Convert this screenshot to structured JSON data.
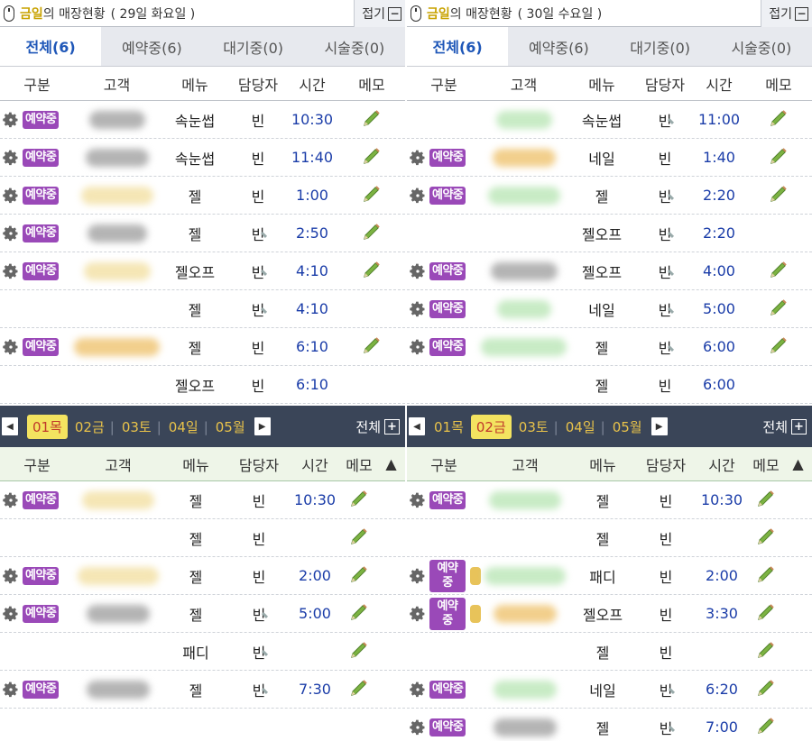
{
  "columns": [
    "구분",
    "고객",
    "메뉴",
    "담당자",
    "시간",
    "메모"
  ],
  "badge_label": "예약중",
  "collapse_label": "접기",
  "all_label": "전체",
  "sort_icon": "▲",
  "panels": [
    {
      "id": "tl",
      "title_highlight": "금일",
      "title_rest": "의 매장현황",
      "title_date": "( 29일 화요일 )",
      "tabs": [
        "전체(6)",
        "예약중(6)",
        "대기중(0)",
        "시술중(0)"
      ],
      "active_tab": 0,
      "rows": [
        {
          "badge": true,
          "coin": false,
          "cust": "gray",
          "menu": "속눈썹",
          "staff": "빈",
          "mark": false,
          "time": "10:30",
          "pencil": true
        },
        {
          "badge": true,
          "coin": false,
          "cust": "gray",
          "menu": "속눈썹",
          "staff": "빈",
          "mark": false,
          "time": "11:40",
          "pencil": true
        },
        {
          "badge": true,
          "coin": false,
          "cust": "yellow",
          "menu": "젤",
          "staff": "빈",
          "mark": false,
          "time": "1:00",
          "pencil": true
        },
        {
          "badge": true,
          "coin": false,
          "cust": "gray",
          "menu": "젤",
          "staff": "빈",
          "mark": true,
          "time": "2:50",
          "pencil": true
        },
        {
          "badge": true,
          "coin": false,
          "cust": "yellow",
          "menu": "젤오프",
          "staff": "빈",
          "mark": true,
          "time": "4:10",
          "pencil": true
        },
        {
          "badge": false,
          "coin": false,
          "cust": "",
          "menu": "젤",
          "staff": "빈",
          "mark": true,
          "time": "4:10",
          "pencil": false
        },
        {
          "badge": true,
          "coin": false,
          "cust": "orange",
          "menu": "젤",
          "staff": "빈",
          "mark": false,
          "time": "6:10",
          "pencil": true
        },
        {
          "badge": false,
          "coin": false,
          "cust": "",
          "menu": "젤오프",
          "staff": "빈",
          "mark": false,
          "time": "6:10",
          "pencil": false
        }
      ]
    },
    {
      "id": "tr",
      "title_highlight": "금일",
      "title_rest": "의 매장현황",
      "title_date": "( 30일 수요일 )",
      "tabs": [
        "전체(6)",
        "예약중(6)",
        "대기중(0)",
        "시술중(0)"
      ],
      "active_tab": 0,
      "rows": [
        {
          "badge": false,
          "coin": false,
          "cust": "green",
          "menu": "속눈썹",
          "staff": "빈",
          "mark": true,
          "time": "11:00",
          "pencil": true
        },
        {
          "badge": true,
          "coin": false,
          "cust": "orange",
          "menu": "네일",
          "staff": "빈",
          "mark": false,
          "time": "1:40",
          "pencil": true
        },
        {
          "badge": true,
          "coin": false,
          "cust": "green",
          "menu": "젤",
          "staff": "빈",
          "mark": true,
          "time": "2:20",
          "pencil": true
        },
        {
          "badge": false,
          "coin": false,
          "cust": "",
          "menu": "젤오프",
          "staff": "빈",
          "mark": true,
          "time": "2:20",
          "pencil": false
        },
        {
          "badge": true,
          "coin": false,
          "cust": "gray",
          "menu": "젤오프",
          "staff": "빈",
          "mark": true,
          "time": "4:00",
          "pencil": true
        },
        {
          "badge": true,
          "coin": false,
          "cust": "green",
          "menu": "네일",
          "staff": "빈",
          "mark": true,
          "time": "5:00",
          "pencil": true
        },
        {
          "badge": true,
          "coin": false,
          "cust": "green",
          "menu": "젤",
          "staff": "빈",
          "mark": true,
          "time": "6:00",
          "pencil": true
        },
        {
          "badge": false,
          "coin": false,
          "cust": "",
          "menu": "젤",
          "staff": "빈",
          "mark": false,
          "time": "6:00",
          "pencil": false
        }
      ]
    },
    {
      "id": "bl",
      "days": [
        "01목",
        "02금",
        "03토",
        "04일",
        "05월"
      ],
      "selected_day": 0,
      "rows": [
        {
          "badge": true,
          "coin": false,
          "cust": "yellow",
          "menu": "젤",
          "staff": "빈",
          "mark": false,
          "time": "10:30",
          "pencil": true
        },
        {
          "badge": false,
          "coin": false,
          "cust": "",
          "menu": "젤",
          "staff": "빈",
          "mark": false,
          "time": "",
          "pencil": true
        },
        {
          "badge": true,
          "coin": false,
          "cust": "yellow",
          "menu": "젤",
          "staff": "빈",
          "mark": false,
          "time": "2:00",
          "pencil": true
        },
        {
          "badge": true,
          "coin": false,
          "cust": "gray",
          "menu": "젤",
          "staff": "빈",
          "mark": true,
          "time": "5:00",
          "pencil": true
        },
        {
          "badge": false,
          "coin": false,
          "cust": "",
          "menu": "패디",
          "staff": "빈",
          "mark": true,
          "time": "",
          "pencil": true
        },
        {
          "badge": true,
          "coin": false,
          "cust": "gray",
          "menu": "젤",
          "staff": "빈",
          "mark": true,
          "time": "7:30",
          "pencil": true
        }
      ]
    },
    {
      "id": "br",
      "days": [
        "01목",
        "02금",
        "03토",
        "04일",
        "05월"
      ],
      "selected_day": 1,
      "rows": [
        {
          "badge": true,
          "coin": false,
          "cust": "green",
          "menu": "젤",
          "staff": "빈",
          "mark": false,
          "time": "10:30",
          "pencil": true
        },
        {
          "badge": false,
          "coin": false,
          "cust": "",
          "menu": "젤",
          "staff": "빈",
          "mark": false,
          "time": "",
          "pencil": true
        },
        {
          "badge": true,
          "coin": true,
          "cust": "green",
          "menu": "패디",
          "staff": "빈",
          "mark": false,
          "time": "2:00",
          "pencil": true
        },
        {
          "badge": true,
          "coin": true,
          "cust": "orange",
          "menu": "젤오프",
          "staff": "빈",
          "mark": false,
          "time": "3:30",
          "pencil": true
        },
        {
          "badge": false,
          "coin": false,
          "cust": "",
          "menu": "젤",
          "staff": "빈",
          "mark": false,
          "time": "",
          "pencil": true
        },
        {
          "badge": true,
          "coin": false,
          "cust": "green",
          "menu": "네일",
          "staff": "빈",
          "mark": true,
          "time": "6:20",
          "pencil": true
        },
        {
          "badge": true,
          "coin": false,
          "cust": "gray",
          "menu": "젤",
          "staff": "빈",
          "mark": true,
          "time": "7:00",
          "pencil": true
        }
      ]
    }
  ]
}
